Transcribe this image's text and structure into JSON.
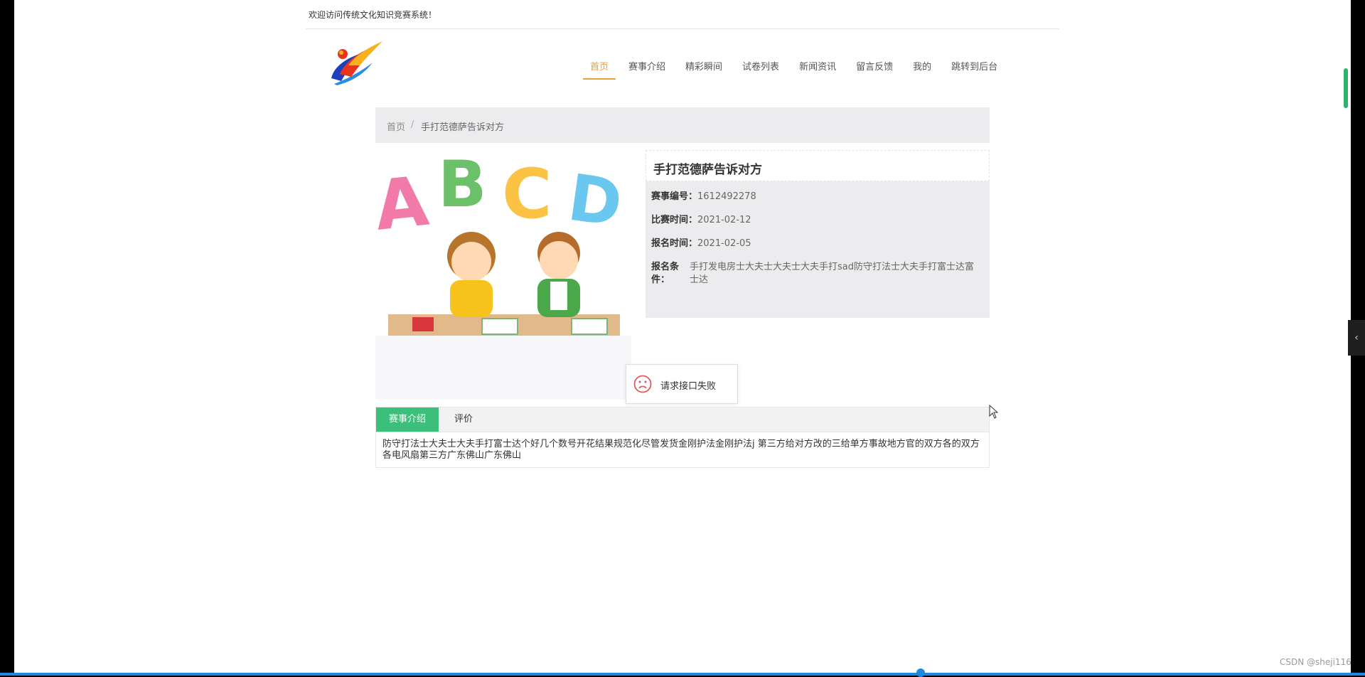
{
  "topbar": {
    "welcome": "欢迎访问传统文化知识竞赛系统！"
  },
  "nav": {
    "items": [
      "首页",
      "赛事介绍",
      "精彩瞬间",
      "试卷列表",
      "新闻资讯",
      "留言反馈",
      "我的",
      "跳转到后台"
    ],
    "active_index": 0
  },
  "breadcrumb": {
    "home": "首页",
    "separator": "/",
    "current": "手打范德萨告诉对方"
  },
  "contest": {
    "title": "手打范德萨告诉对方",
    "number_label": "赛事编号：",
    "number_value": "1612492278",
    "match_time_label": "比赛时间：",
    "match_time_value": "2021-02-12",
    "signup_time_label": "报名时间：",
    "signup_time_value": "2021-02-05",
    "condition_label": "报名条件：",
    "condition_value": "手打发电房士大夫士大夫士大夫手打sad防守打法士大夫手打富士达富士达"
  },
  "illustration": {
    "letters": [
      "A",
      "B",
      "C",
      "D"
    ]
  },
  "toast": {
    "icon": "sad-face-icon",
    "text": "请求接口失败"
  },
  "tabs": {
    "items": [
      "赛事介绍",
      "评价"
    ],
    "active_index": 0,
    "content": "防守打法士大夫士大夫手打富士达个好几个数号开花结果规范化尽管发货金刚护法金刚护法j 第三方给对方改的三给单方事故地方官的双方各的双方各电风扇第三方广东佛山广东佛山"
  },
  "watermark": "CSDN @sheji116",
  "colors": {
    "accent": "#e6a23c",
    "tab_active": "#3cbf7a",
    "toast_icon": "#e05a5a",
    "progress": "#1e88e5"
  }
}
